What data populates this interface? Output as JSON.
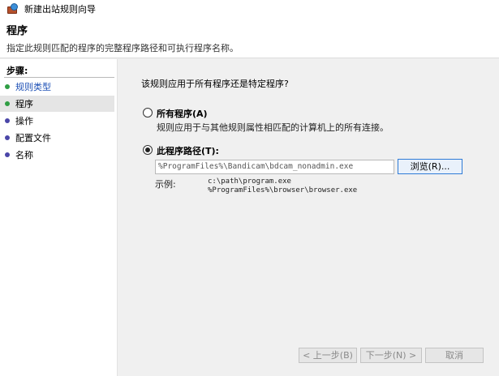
{
  "window": {
    "title": "新建出站规则向导"
  },
  "header": {
    "title": "程序",
    "description": "指定此规则匹配的程序的完整程序路径和可执行程序名称。"
  },
  "steps": {
    "title": "步骤:",
    "items": [
      {
        "label": "规则类型",
        "state": "done"
      },
      {
        "label": "程序",
        "state": "current"
      },
      {
        "label": "操作",
        "state": "pending"
      },
      {
        "label": "配置文件",
        "state": "pending"
      },
      {
        "label": "名称",
        "state": "pending"
      }
    ]
  },
  "main": {
    "question": "该规则应用于所有程序还是特定程序?",
    "all_programs": {
      "label": "所有程序(A)",
      "description": "规则应用于与其他规则属性相匹配的计算机上的所有连接。",
      "selected": false
    },
    "this_program": {
      "label": "此程序路径(T):",
      "selected": true,
      "path_value": "%ProgramFiles%\\Bandicam\\bdcam_nonadmin.exe",
      "browse_label": "浏览(R)..."
    },
    "example": {
      "label": "示例:",
      "lines": [
        "c:\\path\\program.exe",
        "%ProgramFiles%\\browser\\browser.exe"
      ]
    }
  },
  "footer": {
    "back_label": "< 上一步(B)",
    "next_label": "下一步(N) >",
    "cancel_label": "取消"
  }
}
